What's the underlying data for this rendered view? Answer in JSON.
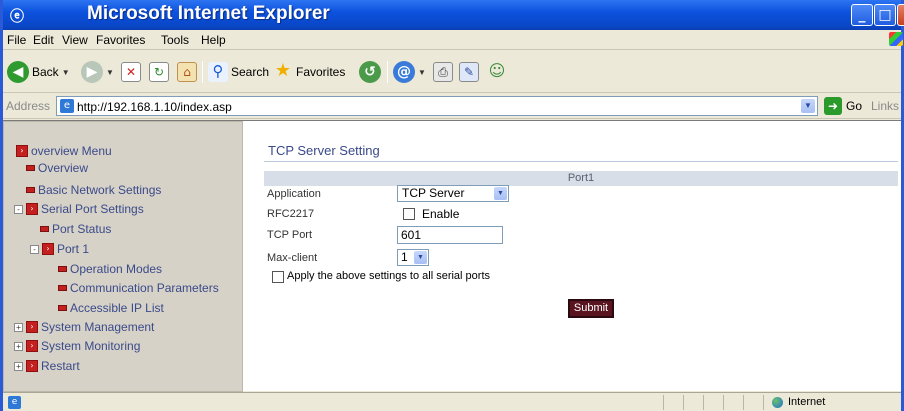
{
  "window": {
    "title": "Microsoft Internet Explorer"
  },
  "menu": [
    "File",
    "Edit",
    "View",
    "Favorites",
    "Tools",
    "Help"
  ],
  "toolbar": {
    "back_label": "Back",
    "search_label": "Search",
    "favorites_label": "Favorites"
  },
  "address": {
    "label": "Address",
    "url": "http://192.168.1.10/index.asp",
    "go_label": "Go",
    "links_label": "Links"
  },
  "nav": {
    "root": "overview Menu",
    "overview": "Overview",
    "basic_network": "Basic Network Settings",
    "serial_port": "Serial Port Settings",
    "port_status": "Port Status",
    "port1": "Port 1",
    "operation_modes": "Operation Modes",
    "comm_params": "Communication Parameters",
    "accessible_ip": "Accessible IP List",
    "system_management": "System Management",
    "system_monitoring": "System Monitoring",
    "restart": "Restart"
  },
  "form": {
    "title": "TCP Server Setting",
    "port_header": "Port1",
    "application_label": "Application",
    "application_value": "TCP Server",
    "rfc_label": "RFC2217",
    "rfc_enable": "Enable",
    "rfc_checked": false,
    "tcp_port_label": "TCP Port",
    "tcp_port_value": "601",
    "max_client_label": "Max-client",
    "max_client_value": "1",
    "apply_all_label": "Apply the above settings to all serial ports",
    "apply_all_checked": false,
    "submit_label": "Submit"
  },
  "status": {
    "zone": "Internet"
  },
  "colors": {
    "nav_text": "#3a4a8a",
    "sidebar_bg": "#d7d2c8",
    "submit_bg": "#5a1420",
    "title_bar": "#0c52de"
  }
}
